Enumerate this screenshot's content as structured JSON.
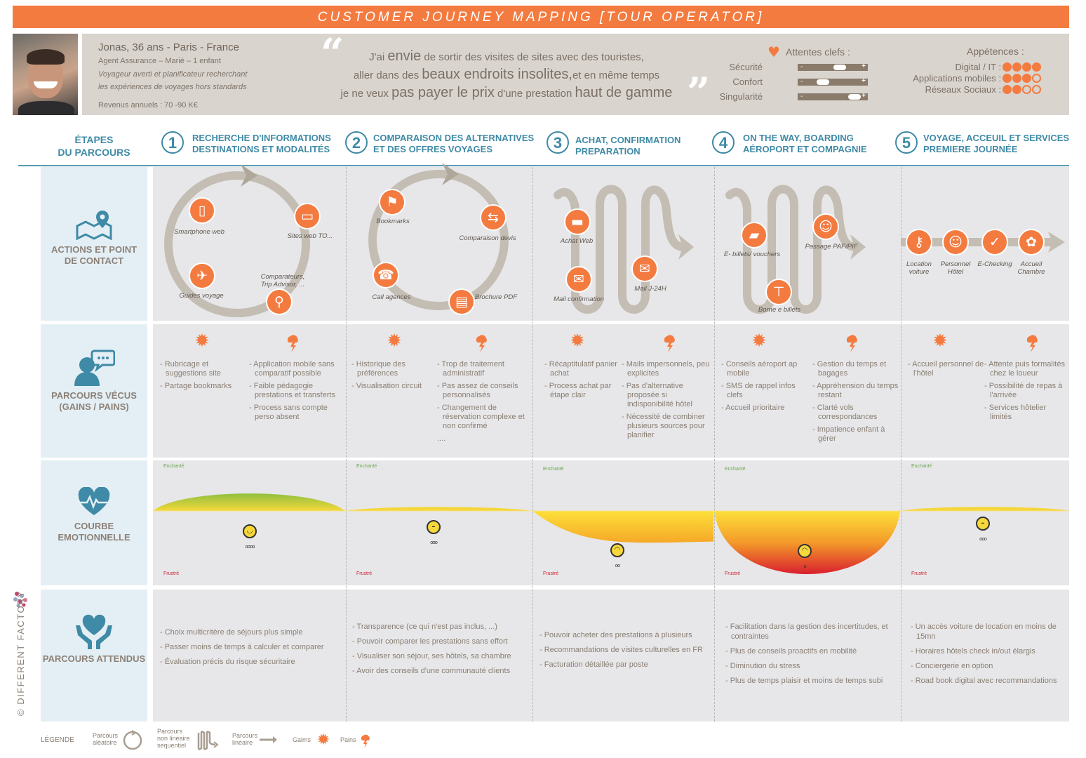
{
  "title": "CUSTOMER JOURNEY MAPPING  [TOUR OPERATOR]",
  "colors": {
    "accent": "#f47b40",
    "teal": "#3f8aa6",
    "text": "#8a7f74",
    "panel": "#e7e7e9",
    "persona_bg": "#d9d4ce"
  },
  "persona": {
    "name": "Jonas, 36 ans - Paris - France",
    "job": "Agent Assurance – Marié – 1 enfant",
    "desc1": "Voyageur averti et planificateur recherchant",
    "desc2": "les expériences de voyages hors standards",
    "income": "Revenus annuels : 70 -90 K€"
  },
  "quote": {
    "l1a": "J'ai ",
    "l1b": "envie",
    "l1c": " de sortir des visites de sites avec des touristes,",
    "l2a": "aller dans des ",
    "l2b": "beaux endroits insolites,",
    "l2c": "et en même temps",
    "l3a": "je ne veux ",
    "l3b": "pas payer le prix",
    "l3c": " d'une prestation ",
    "l3d": "haut de gamme"
  },
  "expectations": {
    "title": "Attentes clefs :",
    "icon": "heart-icon",
    "items": [
      {
        "label": "Sécurité",
        "level": 0.6,
        "minus": "-",
        "plus": "+"
      },
      {
        "label": "Confort",
        "level": 0.3,
        "minus": "-",
        "plus": "+"
      },
      {
        "label": "Singularité",
        "level": 0.87,
        "minus": "-",
        "plus": "+"
      }
    ]
  },
  "appetences": {
    "title": "Appétences :",
    "items": [
      {
        "label": "Digital / IT :",
        "score": 4,
        "max": 4
      },
      {
        "label": "Applications mobiles :",
        "score": 3,
        "max": 4
      },
      {
        "label": "Réseaux Sociaux :",
        "score": 2,
        "max": 4
      }
    ]
  },
  "row_labels": {
    "etapes": [
      "ÉTAPES",
      "DU PARCOURS"
    ],
    "actions": [
      "ACTIONS ET POINT",
      "DE CONTACT"
    ],
    "vecus": [
      "PARCOURS VÉCUS",
      "(GAINS / PAINS)"
    ],
    "courbe": [
      "COURBE",
      "EMOTIONNELLE"
    ],
    "attendus": [
      "PARCOURS ATTENDUS"
    ]
  },
  "emotion_labels": {
    "top": "Enchanté",
    "bottom": "Frustré"
  },
  "stages": [
    {
      "num": "1",
      "title": [
        "RECHERCHE D'INFORMATIONS",
        "DESTINATIONS ET MODALITÉS"
      ],
      "journey": "aléatoire",
      "touchpoints": [
        {
          "label": "Smartphone web",
          "icon": "smartphone-icon"
        },
        {
          "label": "Sites web TO...",
          "icon": "monitor-icon"
        },
        {
          "label": "Guides voyage",
          "icon": "map-icon"
        },
        {
          "label": "Comparateurs, Trip Advisor, ...",
          "icon": "search-icon"
        }
      ],
      "gains": [
        "- Rubricage et suggestions site",
        "- Partage bookmarks"
      ],
      "pains": [
        "- Application mobile sans comparatif possible",
        "- Faible pédagogie prestations et transferts",
        "- Process sans compte perso absent"
      ],
      "emotion": {
        "level": 0.35,
        "mood": "happy",
        "rating": 4
      },
      "attendus": [
        "- Choix multicritère de séjours plus simple",
        "- Passer moins de temps à calculer et comparer",
        "- Évaluation précis du risque sécuritaire"
      ]
    },
    {
      "num": "2",
      "title": [
        "COMPARAISON DES ALTERNATIVES",
        "ET DES OFFRES VOYAGES"
      ],
      "journey": "aléatoire",
      "touchpoints": [
        {
          "label": "Bookmarks",
          "icon": "location-pin-icon"
        },
        {
          "label": "Comparaison devis",
          "icon": "compare-icon"
        },
        {
          "label": "Call agences",
          "icon": "phone-icon"
        },
        {
          "label": "Brochure PDF",
          "icon": "pdf-icon"
        }
      ],
      "gains": [
        "- Historique des préférences",
        "- Visualisation circuit"
      ],
      "pains": [
        "- Trop de traitement administratif",
        "- Pas assez de conseils personnalisés",
        "- Changement de réservation complexe et non confirmé",
        "...."
      ],
      "emotion": {
        "level": 0.08,
        "mood": "neutral",
        "rating": 3
      },
      "attendus": [
        "- Transparence (ce qui n'est pas inclus, ...)",
        "- Pouvoir comparer les prestations sans effort",
        "- Visualiser son séjour, ses hôtels, sa chambre",
        "- Avoir des conseils d'une communauté clients"
      ]
    },
    {
      "num": "3",
      "title": [
        "ACHAT, CONFIRMATION",
        "PREPARATION"
      ],
      "journey": "non linéaire sequentiel",
      "touchpoints": [
        {
          "label": "Achat Web",
          "icon": "credit-card-icon"
        },
        {
          "label": "Mail confirmation",
          "icon": "mail-alert-icon"
        },
        {
          "label": "Mail J-24H",
          "icon": "mail-clock-icon"
        }
      ],
      "gains": [
        "- Récaptitulatif panier achat",
        "- Process achat par étape clair"
      ],
      "pains": [
        "- Mails impersonnels, peu explicites",
        "- Pas d'alternative proposée si indisponibilité hôtel",
        "- Nécessité de combiner plusieurs sources pour planifier"
      ],
      "emotion": {
        "level": -0.48,
        "mood": "sad",
        "rating": 2
      },
      "attendus": [
        "- Pouvoir acheter des prestations à plusieurs",
        "- Recommandations de visites culturelles en FR",
        "- Facturation détaillée par poste"
      ]
    },
    {
      "num": "4",
      "title": [
        "ON THE WAY, BOARDING",
        "AÉROPORT ET COMPAGNIE"
      ],
      "journey": "non linéaire sequentiel",
      "touchpoints": [
        {
          "label": "E- billets/ vouchers",
          "icon": "tickets-icon"
        },
        {
          "label": "Passage PAF/PIF",
          "icon": "officer-icon"
        },
        {
          "label": "Borne e billets",
          "icon": "kiosk-icon"
        }
      ],
      "gains": [
        "- Conseils aéroport ap mobile",
        "- SMS de rappel infos clefs",
        "- Accueil prioritaire"
      ],
      "pains": [
        "- Gestion du temps et bagages",
        "- Appréhension du temps restant",
        "- Clarté vols correspondances",
        "- Impatience enfant à gérer"
      ],
      "emotion": {
        "level": -1.0,
        "mood": "angry",
        "rating": 1
      },
      "attendus": [
        "- Facilitation dans la gestion des incertitudes, et contraintes",
        "- Plus de conseils proactifs en mobilité",
        "- Diminution du stress",
        "- Plus de temps plaisir et moins de temps subi"
      ]
    },
    {
      "num": "5",
      "title": [
        "VOYAGE, ACCEUIL ET SERVICES",
        "PREMIERE JOURNÉE"
      ],
      "journey": "linéaire",
      "touchpoints": [
        {
          "label": "Location voiture",
          "icon": "car-key-icon"
        },
        {
          "label": "Personnel Hôtel",
          "icon": "staff-icon"
        },
        {
          "label": "E-Checking",
          "icon": "mobile-check-icon"
        },
        {
          "label": "Accueil Chambre",
          "icon": "welcome-icon"
        }
      ],
      "gains": [
        "- Accueil personnel de l'hôtel"
      ],
      "pains": [
        "- Attente puis formalités chez le loueur",
        "- Possibilité de repas à l'arrivée",
        "- Services hôtelier limités"
      ],
      "emotion": {
        "level": 0.08,
        "mood": "neutral",
        "rating": 3
      },
      "attendus": [
        "- Un accès voiture de location en moins de 15mn",
        "- Horaires hôtels check in/out élargis",
        "- Conciergerie en option",
        "- Road book digital avec recommandations"
      ]
    }
  ],
  "legend": {
    "title": "LÉGENDE",
    "random": [
      "Parcours",
      "aléatoire"
    ],
    "sequential": [
      "Parcours",
      "non linéaire",
      "sequentiel"
    ],
    "linear": [
      "Parcours",
      "linéaire"
    ],
    "gains": "Gaims",
    "pains": "Pains"
  },
  "brand": "© DIFFERENT FACTORY"
}
